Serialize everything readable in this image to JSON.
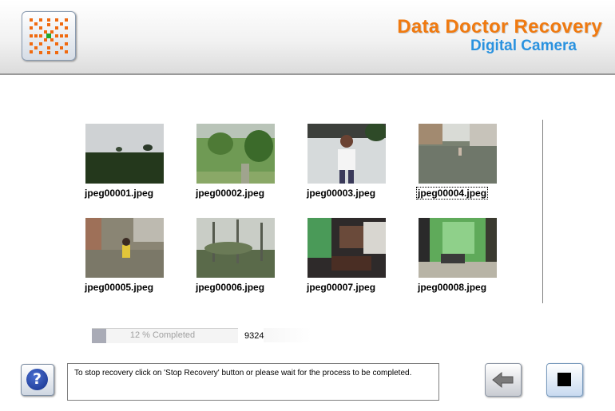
{
  "brand": {
    "title": "Data Doctor Recovery",
    "subtitle": "Digital Camera"
  },
  "colors": {
    "brand_orange": "#f07a10",
    "brand_blue": "#2a92df",
    "accent": "#a9abb6"
  },
  "header": {
    "logo_icon": "recovery-logo-icon"
  },
  "gallery": {
    "items": [
      {
        "filename": "jpeg00001.jpeg",
        "scene": "field-horizon"
      },
      {
        "filename": "jpeg00002.jpeg",
        "scene": "garden-trees"
      },
      {
        "filename": "jpeg00003.jpeg",
        "scene": "child-car"
      },
      {
        "filename": "jpeg00004.jpeg",
        "scene": "flooded-street"
      },
      {
        "filename": "jpeg00005.jpeg",
        "scene": "child-water"
      },
      {
        "filename": "jpeg00006.jpeg",
        "scene": "trees-pond"
      },
      {
        "filename": "jpeg00007.jpeg",
        "scene": "room-table"
      },
      {
        "filename": "jpeg00008.jpeg",
        "scene": "green-room"
      }
    ],
    "focused_index": 3
  },
  "progress": {
    "label": "12 % Completed",
    "fraction": 0.12,
    "count": "9324"
  },
  "status": {
    "message": "To stop recovery click on 'Stop Recovery' button or please wait for the process to be completed."
  },
  "buttons": {
    "help_icon": "question-mark-icon",
    "back_icon": "back-arrow-icon",
    "stop_icon": "stop-icon"
  }
}
